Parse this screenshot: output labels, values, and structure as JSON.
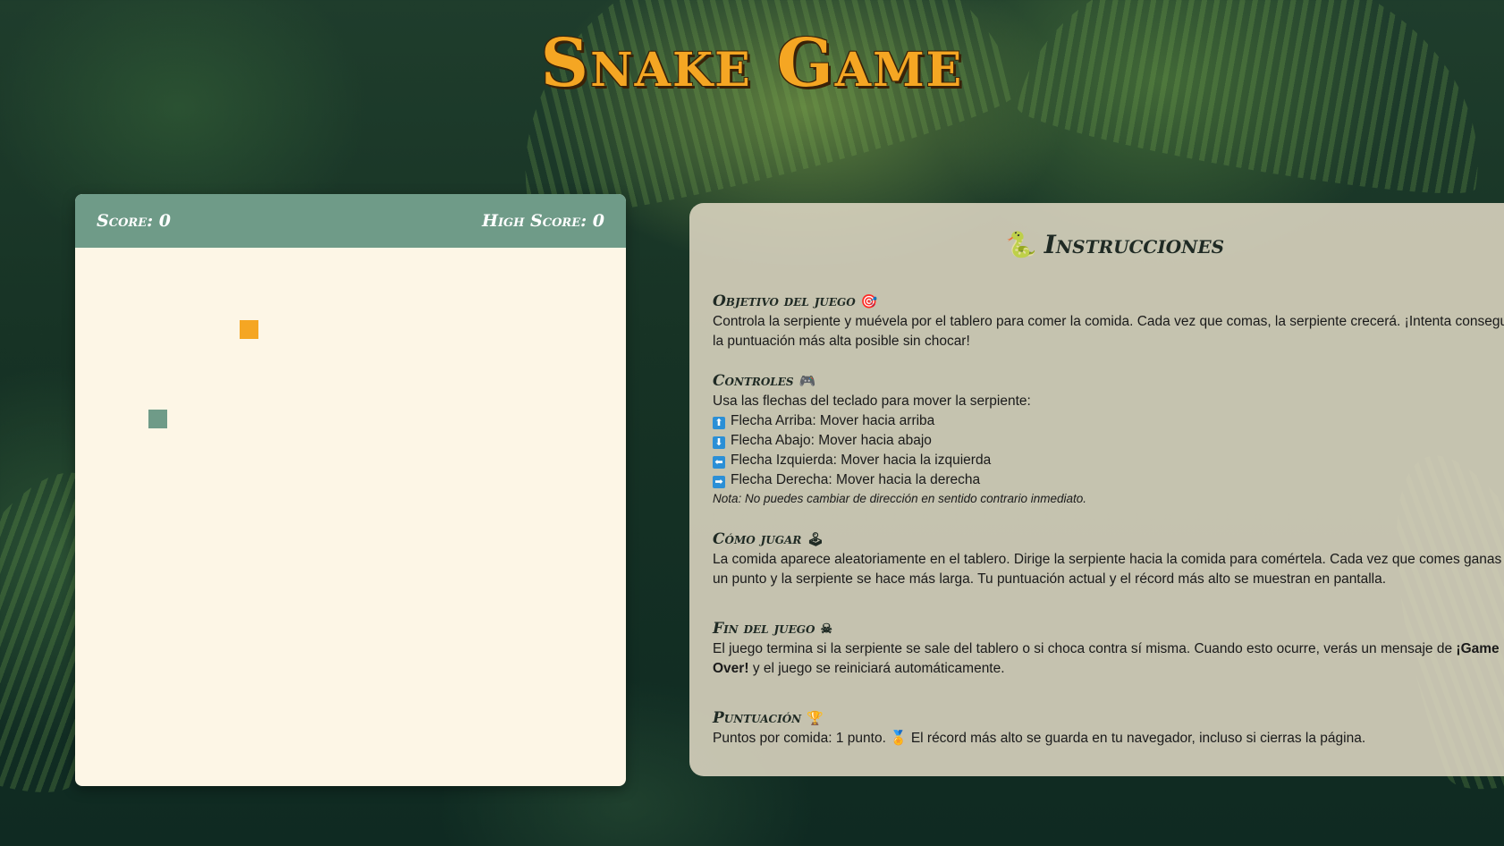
{
  "page": {
    "title": "Snake Game"
  },
  "game": {
    "score_label": "Score: 0",
    "high_score_label": "High Score: 0"
  },
  "instructions": {
    "title": "Instrucciones",
    "title_icon": "🐍",
    "sections": [
      {
        "heading": "Objetivo del juego",
        "emoji": "🎯",
        "text": "Controla la serpiente y muévela por el tablero para comer la comida. Cada vez que comas, la serpiente crecerá. ¡Intenta conseguir la puntuación más alta posible sin chocar!"
      },
      {
        "heading": "Controles",
        "emoji": "🎮",
        "intro": "Usa las flechas del teclado para mover la serpiente:",
        "keys": [
          {
            "arrow": "⬆",
            "text": "Flecha Arriba: Mover hacia arriba"
          },
          {
            "arrow": "⬇",
            "text": "Flecha Abajo: Mover hacia abajo"
          },
          {
            "arrow": "⬅",
            "text": "Flecha Izquierda: Mover hacia la izquierda"
          },
          {
            "arrow": "➡",
            "text": "Flecha Derecha: Mover hacia la derecha"
          }
        ],
        "note": "Nota: No puedes cambiar de dirección en sentido contrario inmediato."
      },
      {
        "heading": "Cómo jugar",
        "emoji": "🕹",
        "text": "La comida aparece aleatoriamente en el tablero. Dirige la serpiente hacia la comida para comértela. Cada vez que comes ganas un punto y la serpiente se hace más larga. Tu puntuación actual y el récord más alto se muestran en pantalla."
      },
      {
        "heading": "Fin del juego",
        "emoji": "☠",
        "text_before": "El juego termina si la serpiente se sale del tablero o si choca contra sí misma. Cuando esto ocurre, verás un mensaje de",
        "text_bold": "¡Game Over!",
        "text_after": "y el juego se reiniciará automáticamente."
      },
      {
        "heading": "Puntuación",
        "emoji": "🏆",
        "text_before": "Puntos por comida: 1 punto.",
        "medal": "🏅",
        "text_after": "El récord más alto se guarda en tu navegador, incluso si cierras la página."
      }
    ]
  },
  "colors": {
    "title": "#f5a623",
    "score_bar": "#6f9b88",
    "board": "#fdf6e6",
    "food": "#f5a623",
    "snake": "#6f9b88",
    "instructions_bg": "#ded7c3"
  }
}
